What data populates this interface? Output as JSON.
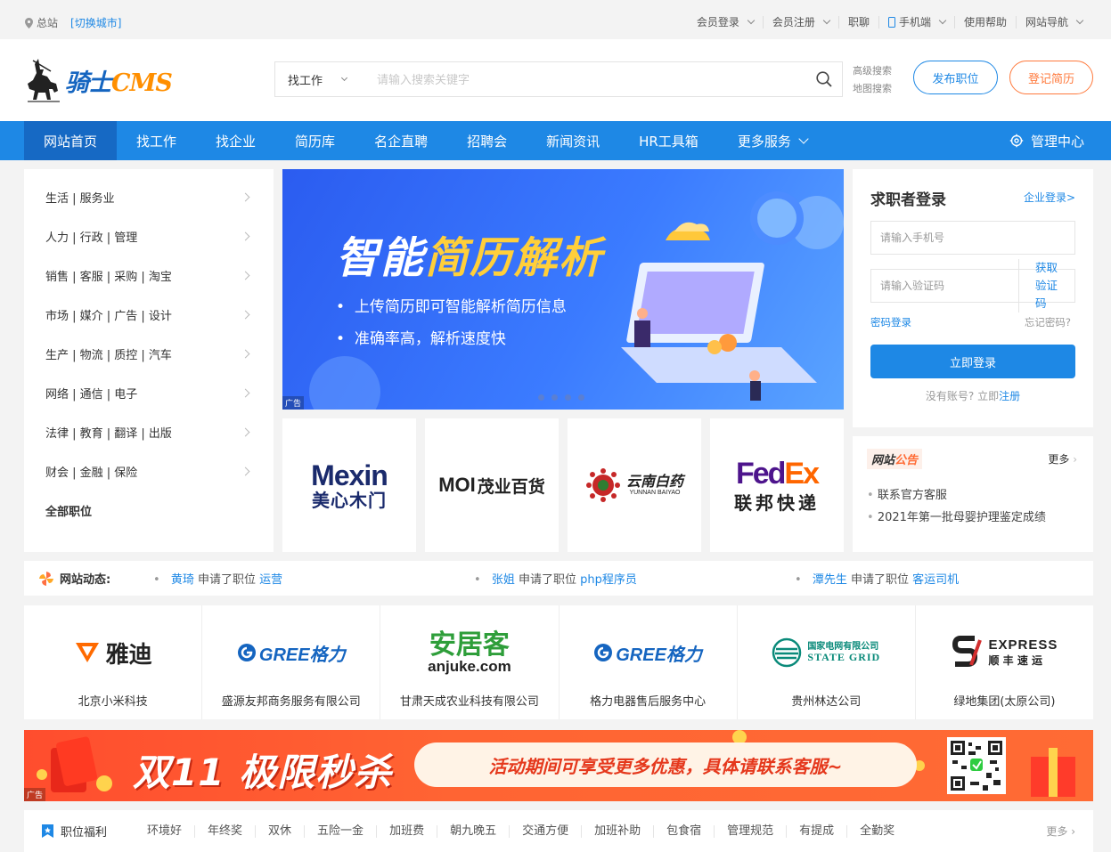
{
  "topbar": {
    "location": "总站",
    "switch_city": "[切换城市]",
    "links": [
      {
        "label": "会员登录",
        "dropdown": true
      },
      {
        "label": "会员注册",
        "dropdown": true
      },
      {
        "label": "职聊",
        "dropdown": false
      },
      {
        "label": "手机端",
        "dropdown": true,
        "icon": "phone-icon"
      },
      {
        "label": "使用帮助",
        "dropdown": false
      },
      {
        "label": "网站导航",
        "dropdown": true
      }
    ]
  },
  "header": {
    "brand_main": "骑士",
    "brand_accent": "CMS",
    "search_type": "找工作",
    "search_placeholder": "请输入搜索关键字",
    "advanced_search": "高级搜索",
    "map_search": "地图搜索",
    "post_job": "发布职位",
    "register_resume": "登记简历"
  },
  "nav": {
    "items": [
      "网站首页",
      "找工作",
      "找企业",
      "简历库",
      "名企直聘",
      "招聘会",
      "新闻资讯",
      "HR工具箱",
      "更多服务"
    ],
    "manage": "管理中心"
  },
  "categories": [
    "生活 | 服务业",
    "人力 | 行政 | 管理",
    "销售 | 客服 | 采购 | 淘宝",
    "市场 | 媒介 | 广告 | 设计",
    "生产 | 物流 | 质控 | 汽车",
    "网络 | 通信 | 电子",
    "法律 | 教育 | 翻译 | 出版",
    "财会 | 金融 | 保险"
  ],
  "all_jobs": "全部职位",
  "banner": {
    "title_a": "智能",
    "title_b": "简历解析",
    "bullet1": "上传简历即可智能解析简历信息",
    "bullet2": "准确率高，解析速度快",
    "ad": "广告"
  },
  "brands": [
    {
      "line1": "Mexin",
      "line2": "美心木门"
    },
    {
      "line1": "MOI",
      "line2": "茂业百货"
    },
    {
      "line1": "云南白药",
      "line2": "YUNNAN BAIYAO"
    },
    {
      "line1": "FedEx",
      "line2": "联邦快递"
    }
  ],
  "login": {
    "title": "求职者登录",
    "enterprise": "企业登录>",
    "phone_placeholder": "请输入手机号",
    "code_placeholder": "请输入验证码",
    "get_code": "获取验证码",
    "pwd_login": "密码登录",
    "forget": "忘记密码?",
    "submit": "立即登录",
    "no_account": "没有账号? 立即",
    "register": "注册"
  },
  "notice": {
    "title_a": "网站",
    "title_b": "公告",
    "more": "更多",
    "items": [
      "联系官方客服",
      "2021年第一批母婴护理鉴定成绩"
    ]
  },
  "dynamics": {
    "title": "网站动态:",
    "items": [
      {
        "name": "黄琦",
        "action": "申请了职位",
        "job": "运营"
      },
      {
        "name": "张姐",
        "action": "申请了职位",
        "job": "php程序员"
      },
      {
        "name": "潭先生",
        "action": "申请了职位",
        "job": "客运司机"
      }
    ]
  },
  "companies": [
    {
      "logo": "雅迪",
      "name": "北京小米科技"
    },
    {
      "logo": "GREE格力",
      "name": "盛源友邦商务服务有限公司"
    },
    {
      "logo": "安居客",
      "logo_sub": "anjuke.com",
      "name": "甘肃天成农业科技有限公司"
    },
    {
      "logo": "GREE格力",
      "name": "格力电器售后服务中心"
    },
    {
      "logo": "国家电网有限公司",
      "logo_sub": "STATE GRID",
      "name": "贵州林达公司"
    },
    {
      "logo": "EXPRESS",
      "logo_sub": "顺 丰 速 运",
      "name": "绿地集团(太原公司)"
    }
  ],
  "promo": {
    "big": "双11 极限秒杀",
    "text": "活动期间可享受更多优惠，具体请联系客服~",
    "ad": "广告"
  },
  "welfare": {
    "title": "职位福利",
    "tags": [
      "环境好",
      "年终奖",
      "双休",
      "五险一金",
      "加班费",
      "朝九晚五",
      "交通方便",
      "加班补助",
      "包食宿",
      "管理规范",
      "有提成",
      "全勤奖"
    ],
    "more": "更多"
  },
  "colors": {
    "primary": "#1e88e5",
    "nav_active": "#1669c4",
    "orange": "#ff7a3d",
    "promo": "#ff5530"
  }
}
